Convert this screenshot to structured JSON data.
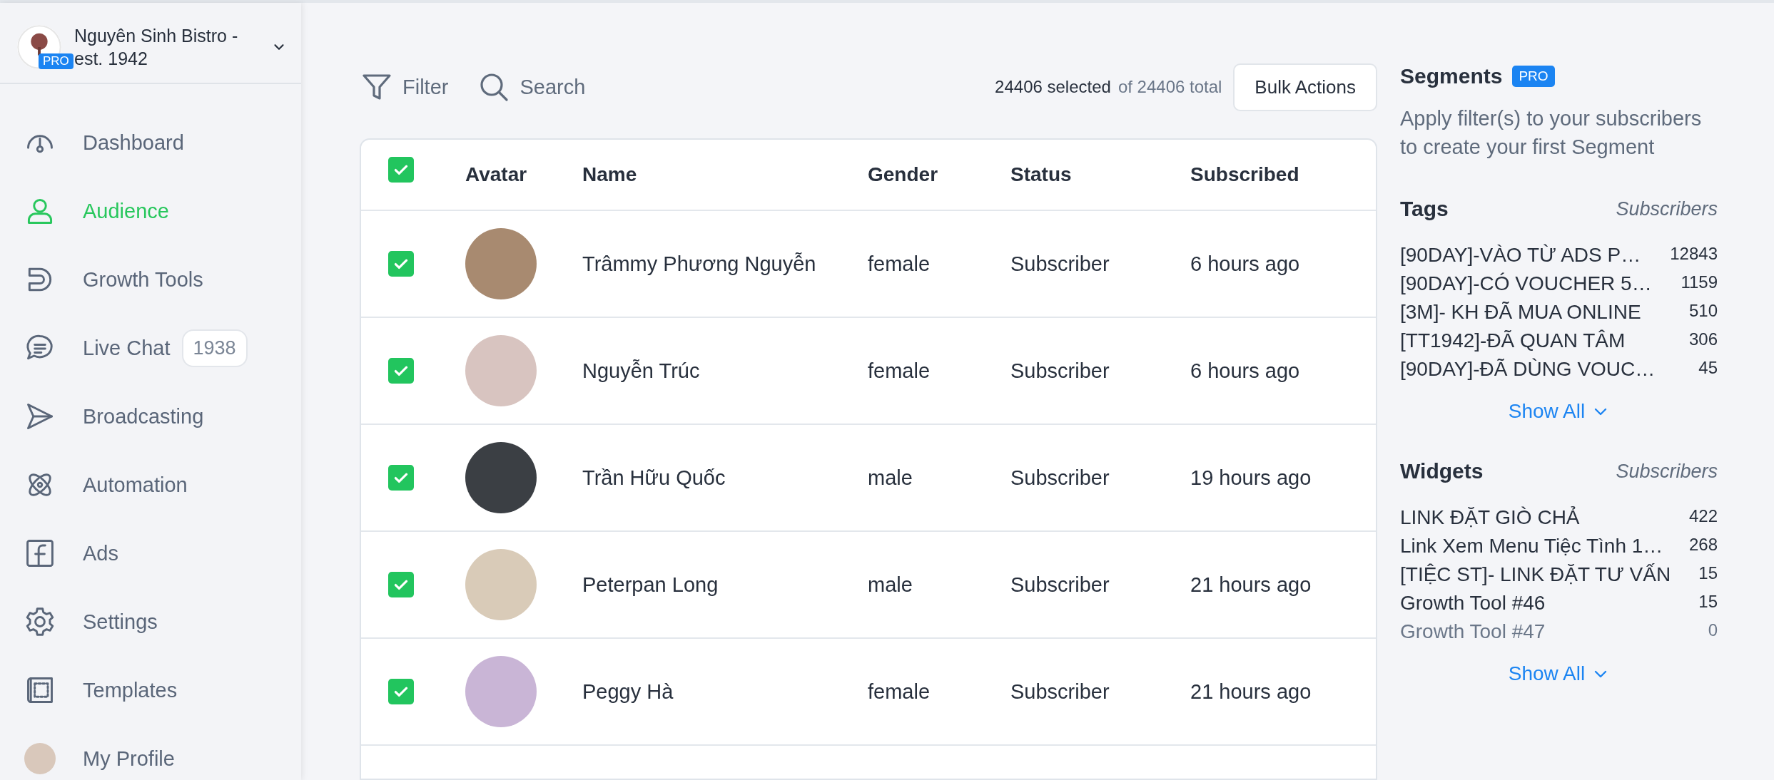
{
  "account": {
    "name": "Nguyên Sinh Bistro - est. 1942",
    "badge": "PRO"
  },
  "nav": [
    {
      "label": "Dashboard",
      "selected": false
    },
    {
      "label": "Audience",
      "selected": true
    },
    {
      "label": "Growth Tools",
      "selected": false
    },
    {
      "label": "Live Chat",
      "selected": false,
      "count": "1938"
    },
    {
      "label": "Broadcasting",
      "selected": false
    },
    {
      "label": "Automation",
      "selected": false
    },
    {
      "label": "Ads",
      "selected": false
    },
    {
      "label": "Settings",
      "selected": false
    },
    {
      "label": "Templates",
      "selected": false
    },
    {
      "label": "My Profile",
      "selected": false
    }
  ],
  "toolbar": {
    "filter": "Filter",
    "search": "Search",
    "selected": "24406 selected",
    "total": "of 24406 total",
    "bulk_button": "Bulk Actions"
  },
  "table": {
    "all_checked": true,
    "columns": [
      "Avatar",
      "Name",
      "Gender",
      "Status",
      "Subscribed"
    ],
    "rows": [
      {
        "checked": true,
        "name": "Trâmmy Phương Nguyễn",
        "gender": "female",
        "status": "Subscriber",
        "subscribed": "6 hours ago"
      },
      {
        "checked": true,
        "name": "Nguyễn Trúc",
        "gender": "female",
        "status": "Subscriber",
        "subscribed": "6 hours ago"
      },
      {
        "checked": true,
        "name": "Trần Hữu Quốc",
        "gender": "male",
        "status": "Subscriber",
        "subscribed": "19 hours ago"
      },
      {
        "checked": true,
        "name": "Peterpan Long",
        "gender": "male",
        "status": "Subscriber",
        "subscribed": "21 hours ago"
      },
      {
        "checked": true,
        "name": "Peggy Hà",
        "gender": "female",
        "status": "Subscriber",
        "subscribed": "21 hours ago"
      }
    ]
  },
  "segments": {
    "title": "Segments",
    "badge": "PRO",
    "description": "Apply filter(s) to your subscribers to create your first Segment"
  },
  "lists": [
    {
      "title": "Tags",
      "column": "Subscribers",
      "show_all": "Show All",
      "items": [
        {
          "label": "[90DAY]-VÀO TỪ ADS P…",
          "count": "12843",
          "disabled": false
        },
        {
          "label": "[90DAY]-CÓ VOUCHER 5…",
          "count": "1159",
          "disabled": false
        },
        {
          "label": "[3M]- KH ĐÃ MUA ONLINE",
          "count": "510",
          "disabled": false
        },
        {
          "label": "[TT1942]-ĐÃ QUAN TÂM",
          "count": "306",
          "disabled": false
        },
        {
          "label": "[90DAY]-ĐÃ DÙNG VOUC…",
          "count": "45",
          "disabled": false
        }
      ]
    },
    {
      "title": "Widgets",
      "column": "Subscribers",
      "show_all": "Show All",
      "items": [
        {
          "label": "LINK ĐẶT GIÒ CHẢ",
          "count": "422",
          "disabled": false
        },
        {
          "label": "Link Xem Menu Tiệc Tình 1…",
          "count": "268",
          "disabled": false
        },
        {
          "label": "[TIỆC ST]- LINK ĐẶT TƯ VẤN",
          "count": "15",
          "disabled": false
        },
        {
          "label": "Growth Tool #46",
          "count": "15",
          "disabled": false
        },
        {
          "label": "Growth Tool #47",
          "count": "0",
          "disabled": true
        }
      ]
    }
  ]
}
